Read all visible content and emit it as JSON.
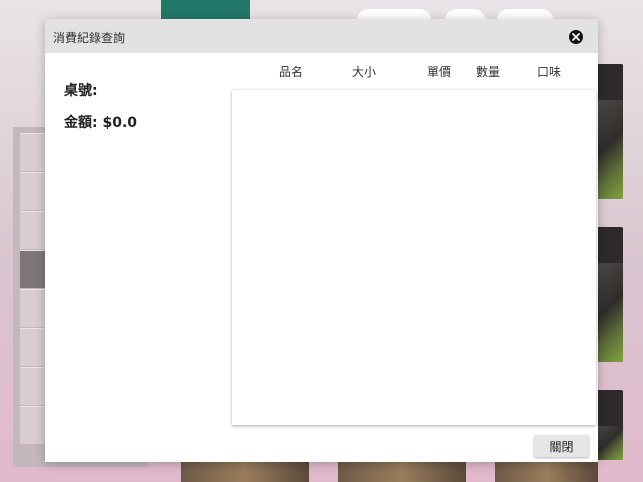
{
  "background": {
    "nav": {
      "green_tab": "",
      "pills": [
        "",
        "",
        ""
      ],
      "right_label": "",
      "card_prices": [
        "",
        "",
        ""
      ]
    }
  },
  "modal": {
    "title": "消費紀錄查詢",
    "table_label": "桌號:",
    "amount_label": "金額: $0.0",
    "columns": [
      "品名",
      "大小",
      "單價",
      "數量",
      "口味"
    ],
    "close_button": "關閉"
  }
}
